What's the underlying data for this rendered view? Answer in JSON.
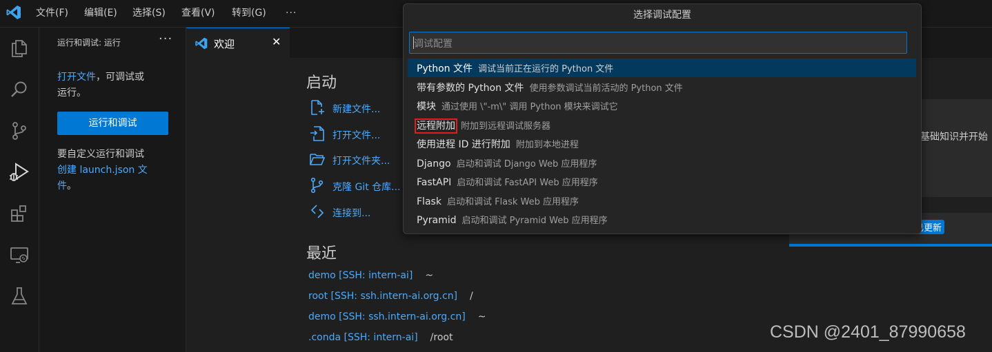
{
  "titlebar": {
    "menus": [
      "文件(F)",
      "编辑(E)",
      "选择(S)",
      "查看(V)",
      "转到(G)"
    ],
    "more": "···"
  },
  "activitybar": {
    "icons": [
      "explorer-icon",
      "search-icon",
      "source-control-icon",
      "run-debug-icon",
      "extensions-icon",
      "remote-explorer-icon",
      "testing-icon"
    ]
  },
  "sidebar": {
    "title": "运行和调试: 运行",
    "more": "···",
    "open_file_link": "打开文件",
    "open_file_rest": "，可调试或",
    "open_file_line2": "运行。",
    "run_button": "运行和调试",
    "customize_text": "要自定义运行和调试",
    "create_link_line1": "创建 launch.json 文",
    "create_link_line2": "件",
    "create_link_end": "。"
  },
  "tabs": [
    {
      "label": "欢迎",
      "close": "✕",
      "active": true
    }
  ],
  "welcome": {
    "start_title": "启动",
    "start_items": [
      {
        "label": "新建文件...",
        "icon": "new-file-icon"
      },
      {
        "label": "打开文件...",
        "icon": "open-file-icon"
      },
      {
        "label": "打开文件夹...",
        "icon": "open-folder-icon"
      },
      {
        "label": "克隆 Git 仓库...",
        "icon": "clone-git-icon"
      },
      {
        "label": "连接到...",
        "icon": "remote-connect-icon"
      }
    ],
    "recent_title": "最近",
    "recent_items": [
      {
        "name": "demo [SSH: intern-ai]",
        "path": "~"
      },
      {
        "name": "root [SSH: ssh.intern-ai.org.cn]",
        "path": "/"
      },
      {
        "name": "demo [SSH: ssh.intern-ai.org.cn]",
        "path": "~"
      },
      {
        "name": ".conda [SSH: intern-ai]",
        "path": "/root"
      }
    ],
    "right_partial_text": "基础知识并开始",
    "right_badge": "已更新"
  },
  "quickpick": {
    "title": "选择调试配置",
    "placeholder": "调试配置",
    "items": [
      {
        "label": "Python 文件",
        "description": "调试当前正在运行的 Python 文件",
        "selected": true,
        "highlighted": false
      },
      {
        "label": "带有参数的 Python 文件",
        "description": "使用参数调试当前活动的 Python 文件",
        "selected": false,
        "highlighted": false
      },
      {
        "label": "模块",
        "description": "通过使用 \\\"-m\\\" 调用 Python 模块来调试它",
        "selected": false,
        "highlighted": false
      },
      {
        "label": "远程附加",
        "description": "附加到远程调试服务器",
        "selected": false,
        "highlighted": true
      },
      {
        "label": "使用进程 ID 进行附加",
        "description": "附加到本地进程",
        "selected": false,
        "highlighted": false
      },
      {
        "label": "Django",
        "description": "启动和调试 Django Web 应用程序",
        "selected": false,
        "highlighted": false
      },
      {
        "label": "FastAPI",
        "description": "启动和调试 FastAPI Web 应用程序",
        "selected": false,
        "highlighted": false
      },
      {
        "label": "Flask",
        "description": "启动和调试 Flask Web 应用程序",
        "selected": false,
        "highlighted": false
      },
      {
        "label": "Pyramid",
        "description": "启动和调试 Pyramid Web 应用程序",
        "selected": false,
        "highlighted": false
      }
    ]
  },
  "watermark": "CSDN @2401_87990658",
  "colors": {
    "accent": "#0078d4",
    "link": "#4daafc",
    "selection": "#04395e",
    "highlight_box": "#e0201c"
  }
}
